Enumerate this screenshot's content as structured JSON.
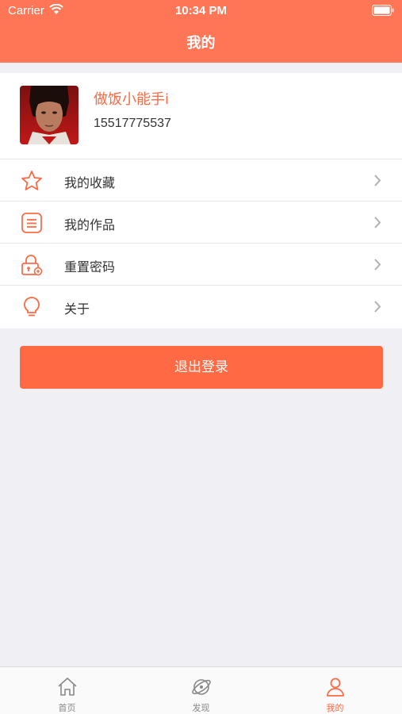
{
  "status_bar": {
    "carrier": "Carrier",
    "time": "10:34 PM"
  },
  "nav": {
    "title": "我的"
  },
  "profile": {
    "username": "做饭小能手i",
    "phone": "15517775537"
  },
  "menu": [
    {
      "label": "我的收藏",
      "icon": "star-icon"
    },
    {
      "label": "我的作品",
      "icon": "document-icon"
    },
    {
      "label": "重置密码",
      "icon": "lock-icon"
    },
    {
      "label": "关于",
      "icon": "lightbulb-icon"
    }
  ],
  "logout_label": "退出登录",
  "tabs": [
    {
      "label": "首页",
      "icon": "home-icon",
      "active": false
    },
    {
      "label": "发现",
      "icon": "planet-icon",
      "active": false
    },
    {
      "label": "我的",
      "icon": "person-icon",
      "active": true
    }
  ],
  "colors": {
    "accent": "#ff6a45",
    "header": "#ff7656",
    "background": "#efeff4"
  }
}
